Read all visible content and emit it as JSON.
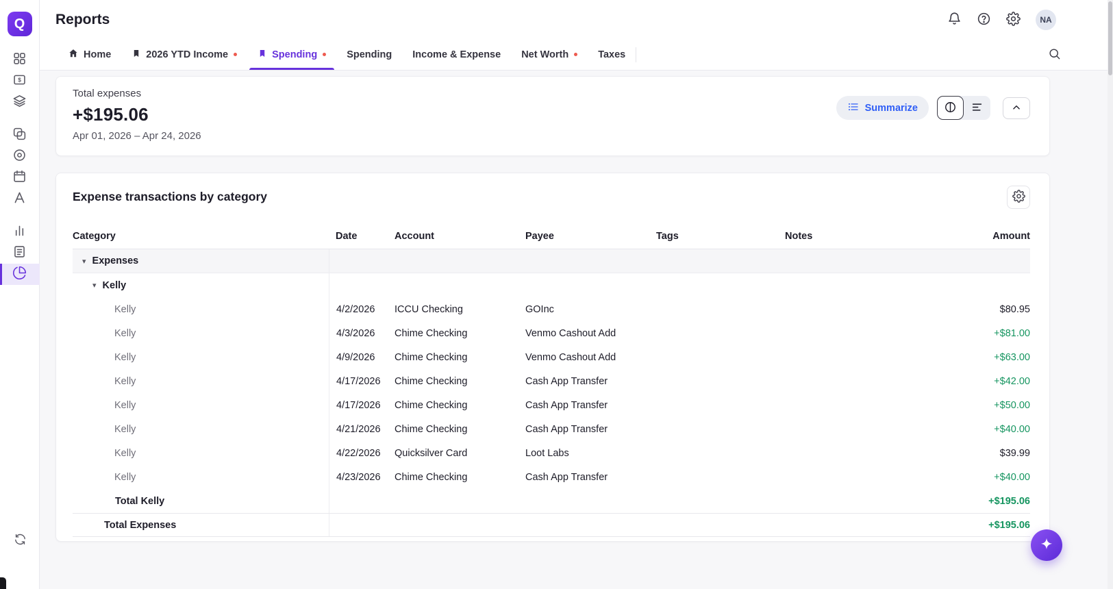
{
  "brand": {
    "logo_letter": "Q"
  },
  "colors": {
    "accent": "#6732dc",
    "positive": "#169560",
    "tab_dot": "#ee5a4f",
    "summarize_blue": "#2f5ef6"
  },
  "header": {
    "title": "Reports",
    "avatar": "NA"
  },
  "sidebar": {
    "items": [
      {
        "name": "dashboard",
        "icon": "grid-icon"
      },
      {
        "name": "transactions",
        "icon": "dollar-icon"
      },
      {
        "name": "bills",
        "icon": "layers-icon"
      },
      {
        "name": "accounts",
        "icon": "overlap-icon",
        "group_start": true
      },
      {
        "name": "goals",
        "icon": "target-icon"
      },
      {
        "name": "calendar",
        "icon": "calendar-icon"
      },
      {
        "name": "advice",
        "icon": "aframe-icon"
      },
      {
        "name": "investments",
        "icon": "bar-chart-icon",
        "group_start": true
      },
      {
        "name": "watchlist",
        "icon": "report-icon"
      },
      {
        "name": "reports",
        "icon": "pie-chart-icon",
        "active": true
      }
    ],
    "bottom_item": {
      "name": "sync",
      "icon": "sync-icon"
    }
  },
  "tabs": [
    {
      "label": "Home",
      "icon": "home-icon"
    },
    {
      "label": "2026 YTD Income",
      "icon": "bookmark-icon",
      "dot": true
    },
    {
      "label": "Spending",
      "icon": "bookmark-icon",
      "dot": true,
      "active": true
    },
    {
      "label": "Spending"
    },
    {
      "label": "Income & Expense"
    },
    {
      "label": "Net Worth",
      "dot": true
    },
    {
      "label": "Taxes"
    }
  ],
  "summary": {
    "label": "Total expenses",
    "amount": "+$195.06",
    "date_range": "Apr 01, 2026 – Apr 24, 2026",
    "summarize_label": "Summarize"
  },
  "table": {
    "title": "Expense transactions by category",
    "columns": [
      "Category",
      "Date",
      "Account",
      "Payee",
      "Tags",
      "Notes",
      "Amount"
    ],
    "rows": [
      {
        "type": "group",
        "level": 1,
        "label": "Expenses"
      },
      {
        "type": "group",
        "level": 2,
        "label": "Kelly"
      },
      {
        "type": "data",
        "category": "Kelly",
        "date": "4/2/2026",
        "account": "ICCU Checking",
        "payee": "GOInc",
        "tags": "",
        "notes": "",
        "amount": "$80.95",
        "positive": false
      },
      {
        "type": "data",
        "category": "Kelly",
        "date": "4/3/2026",
        "account": "Chime Checking",
        "payee": "Venmo Cashout Add",
        "tags": "",
        "notes": "",
        "amount": "+$81.00",
        "positive": true
      },
      {
        "type": "data",
        "category": "Kelly",
        "date": "4/9/2026",
        "account": "Chime Checking",
        "payee": "Venmo Cashout Add",
        "tags": "",
        "notes": "",
        "amount": "+$63.00",
        "positive": true
      },
      {
        "type": "data",
        "category": "Kelly",
        "date": "4/17/2026",
        "account": "Chime Checking",
        "payee": "Cash App Transfer",
        "tags": "",
        "notes": "",
        "amount": "+$42.00",
        "positive": true
      },
      {
        "type": "data",
        "category": "Kelly",
        "date": "4/17/2026",
        "account": "Chime Checking",
        "payee": "Cash App Transfer",
        "tags": "",
        "notes": "",
        "amount": "+$50.00",
        "positive": true
      },
      {
        "type": "data",
        "category": "Kelly",
        "date": "4/21/2026",
        "account": "Chime Checking",
        "payee": "Cash App Transfer",
        "tags": "",
        "notes": "",
        "amount": "+$40.00",
        "positive": true
      },
      {
        "type": "data",
        "category": "Kelly",
        "date": "4/22/2026",
        "account": "Quicksilver Card",
        "payee": "Loot Labs",
        "tags": "",
        "notes": "",
        "amount": "$39.99",
        "positive": false
      },
      {
        "type": "data",
        "category": "Kelly",
        "date": "4/23/2026",
        "account": "Chime Checking",
        "payee": "Cash App Transfer",
        "tags": "",
        "notes": "",
        "amount": "+$40.00",
        "positive": true
      },
      {
        "type": "total",
        "level": 2,
        "label": "Total Kelly",
        "amount": "+$195.06",
        "positive": true
      },
      {
        "type": "total",
        "level": 1,
        "label": "Total Expenses",
        "amount": "+$195.06",
        "positive": true
      }
    ]
  }
}
